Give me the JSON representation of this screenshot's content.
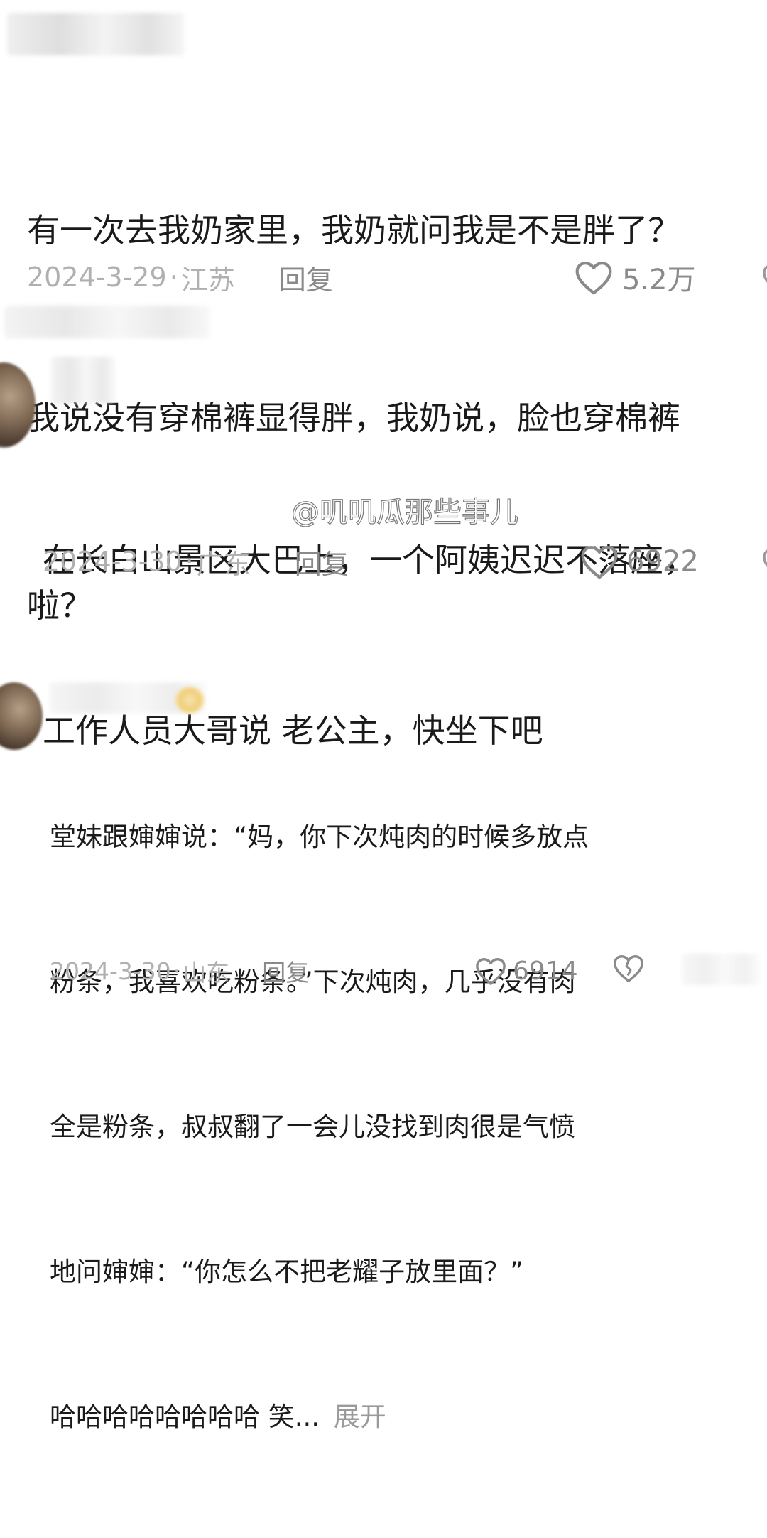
{
  "comments": [
    {
      "text_lines": [
        "有一次去我奶家里，我奶就问我是不是胖了？",
        "我说没有穿棉裤显得胖，我奶说，脸也穿棉裤",
        "啦？"
      ],
      "date": "2024-3-29",
      "location": "江苏",
      "reply_label": "回复",
      "likes": "5.2万",
      "like_icon": "heart-outline-icon"
    },
    {
      "text_lines": [
        "在长白山景区大巴上，一个阿姨迟迟不落座，",
        "工作人员大哥说 老公主，快坐下吧"
      ],
      "date": "2024-3-30",
      "location": "广东",
      "reply_label": "回复",
      "likes": "6922",
      "like_icon": "heart-outline-icon"
    },
    {
      "text_lines": [
        "堂妹跟婶婶说：“妈，你下次炖肉的时候多放点",
        "粉条，我喜欢吃粉条。”下次炖肉，几乎没有肉",
        "全是粉条，叔叔翻了一会儿没找到肉很是气愤",
        "地问婶婶：“你怎么不把老耀子放里面？”",
        "哈哈哈哈哈哈哈哈 笑..."
      ],
      "expand_label": "展开",
      "date": "2024-3-30",
      "location": "山东",
      "reply_label": "回复",
      "likes": "6914",
      "like_icon": "heart-outline-icon",
      "dislike_icon": "broken-heart-icon"
    }
  ],
  "watermark": "@叽叽瓜那些事儿"
}
